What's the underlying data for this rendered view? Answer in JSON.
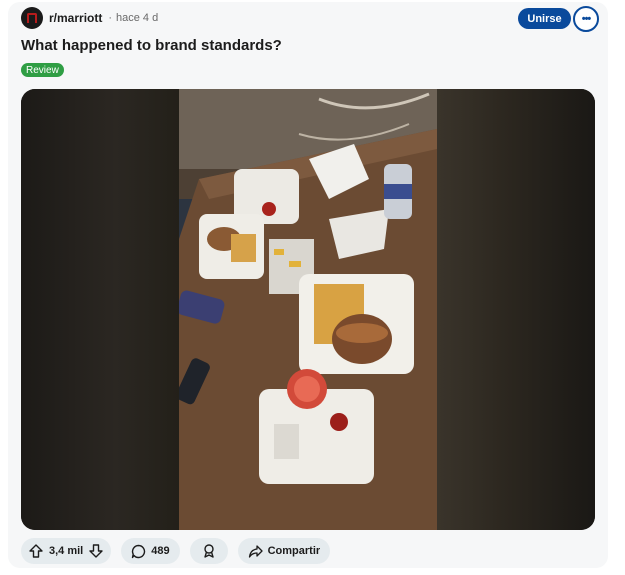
{
  "post": {
    "community": "r/marriott",
    "separator": "·",
    "time": "hace 4 d",
    "title": "What happened to brand standards?",
    "flair": "Review",
    "join_label": "Unirse",
    "more_label": "•••"
  },
  "actions": {
    "votes": "3,4 mil",
    "comments": "489",
    "share_label": "Compartir"
  },
  "colors": {
    "join_button": "#0a4a9c",
    "flair": "#2f9e44",
    "card_background": "#f6f7f8",
    "action_pill": "#e5ebee"
  }
}
